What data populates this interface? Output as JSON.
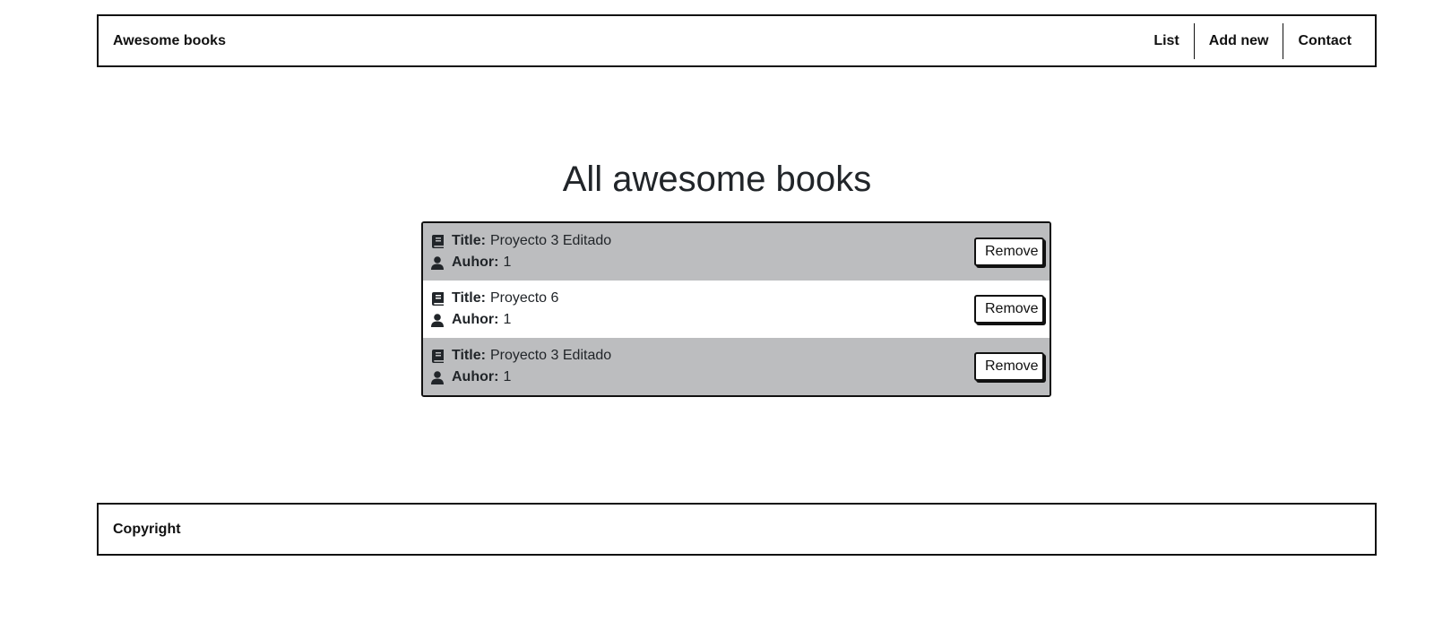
{
  "header": {
    "brand": "Awesome books",
    "nav": [
      {
        "label": "List"
      },
      {
        "label": "Add new"
      },
      {
        "label": "Contact"
      }
    ]
  },
  "main": {
    "title": "All awesome books",
    "title_label": "Title:",
    "author_label": "Auhor:",
    "remove_label": "Remove",
    "books": [
      {
        "title": "Proyecto 3 Editado",
        "author": "1"
      },
      {
        "title": "Proyecto 6",
        "author": "1"
      },
      {
        "title": "Proyecto 3 Editado",
        "author": "1"
      }
    ]
  },
  "footer": {
    "text": "Copyright"
  },
  "icons": {
    "book": "book-icon",
    "author": "user-icon"
  },
  "colors": {
    "row_shaded": "#bcbdbf",
    "row_plain": "#ffffff",
    "border": "#111111",
    "text": "#212529"
  }
}
